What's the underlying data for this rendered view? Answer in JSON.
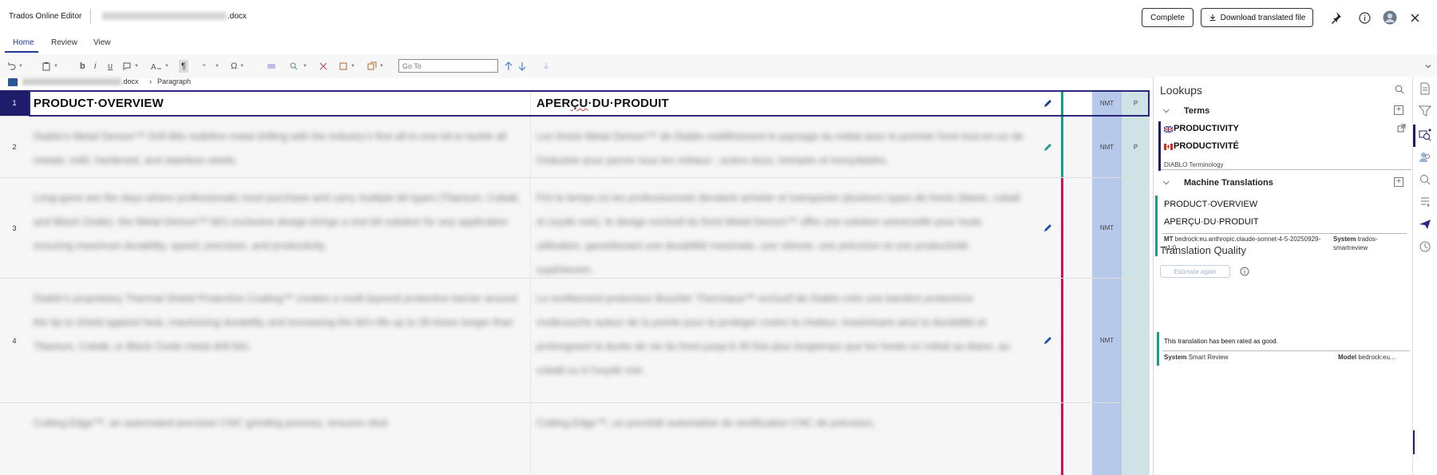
{
  "header": {
    "app_title": "Trados Online Editor",
    "file_suffix": ".docx",
    "complete_label": "Complete",
    "download_label": "Download translated file",
    "icons": [
      "pin-icon",
      "info-icon",
      "avatar",
      "close-icon"
    ]
  },
  "tabs": [
    {
      "label": "Home",
      "active": true
    },
    {
      "label": "Review",
      "active": false
    },
    {
      "label": "View",
      "active": false
    }
  ],
  "toolbar": {
    "goto_placeholder": "Go To",
    "bold": "b",
    "italic": "i",
    "underline": "u",
    "pilcrow": "¶",
    "omega": "Ω"
  },
  "breadcrumb": {
    "file_suffix": ".docx",
    "separator": "›",
    "current": "Paragraph"
  },
  "segments": [
    {
      "num": "1",
      "source": "PRODUCT·OVERVIEW",
      "target_prefix": "APER",
      "target_squiggle": "ÇU",
      "target_suffix": "·DU·PRODUIT",
      "origin": "NMT",
      "status": "P",
      "bar_color": "#1e9a88"
    },
    {
      "num": "2",
      "source": "Diablo's Metal Demon™ Drill Bits redefine metal drilling with the industry's first all-in-one bit to tackle all metals: mild, hardened, and stainless steels.",
      "target": "Les forets Metal Demon™ de Diablo redéfinissent le paysage du métal avec le premier foret tout-en-un de l'industrie pour percer tous les métaux : aciers doux, trempés et inoxydables.",
      "origin": "NMT",
      "status": "P",
      "bar_color": "#1e9a88"
    },
    {
      "num": "3",
      "source": "Long-gone are the days where professionals must purchase and carry multiple bit types (Titanium, Cobalt, and Black Oxide). the Metal Demon™ bit's exclusive design brings a one-bit solution for any application ensuring maximum durability, speed, precision, and productivity.",
      "target": "Fini le temps où les professionnels devaient acheter et transporter plusieurs types de forets (titane, cobalt et oxyde noir). le design exclusif du foret Metal Demon™ offre une solution universelle pour toute utilisation, garantissant une durabilité maximale, une vitesse, une précision et une productivité supérieures.",
      "origin": "NMT",
      "status": "",
      "bar_color": "#c2185b"
    },
    {
      "num": "4",
      "source": "Diablo's proprietary Thermal Shield Protective Coating™ creates a multi-layered protective barrier around the tip to shield against heat, maximizing durability and increasing the bit's life up to 30-times longer than Titanium, Cobalt, or Black Oxide metal drill bits.",
      "target": "Le revêtement protecteur Bouclier Thermique™ exclusif de Diablo crée une barrière protectrice multicouche autour de la pointe pour la protéger contre la chaleur, maximisant ainsi la durabilité et prolongeant la durée de vie du foret jusqu'à 30 fois plus longtemps que les forets en métal au titane, au cobalt ou à l'oxyde noir.",
      "origin": "NMT",
      "status": "",
      "bar_color": "#c2185b"
    },
    {
      "num": "",
      "source": "Cutting Edge™, an automated precision CNC grinding process, ensures stick",
      "target": "Cutting Edge™, un procédé automatisé de rectification CNC de précision,",
      "origin": "",
      "status": "",
      "bar_color": "#c2185b"
    }
  ],
  "panel": {
    "title": "Lookups",
    "terms_header": "Terms",
    "term_source": "PRODUCTIVITY",
    "term_target": "PRODUCTIVITÉ",
    "term_db": "DIABLO Terminology",
    "mt_header": "Machine Translations",
    "mt_source": "PRODUCT·OVERVIEW",
    "mt_target": "APERÇU·DU·PRODUIT",
    "mt_label": "MT",
    "mt_value": "bedrock:eu.anthropic.claude-sonnet-4-5-20250929-v1:0",
    "system_label": "System",
    "system_value": "trados-smartreview",
    "tq_title": "Translation Quality",
    "tq_button": "Estimate again",
    "rating_message": "This translation has been rated as good.",
    "rating_system_label": "System",
    "rating_system_value": "Smart Review",
    "rating_model_label": "Model",
    "rating_model_value": "bedrock:eu..."
  },
  "colors": {
    "accent": "#1f1d6b",
    "teal": "#1e9a88",
    "magenta": "#c2185b",
    "nmt_bg": "#b7c9ea",
    "status_bg": "#cfe3e6"
  }
}
